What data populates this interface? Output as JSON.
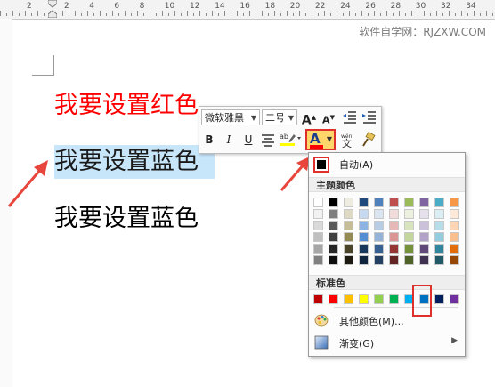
{
  "ruler": {
    "numbers": [
      "2",
      "2",
      "4",
      "6",
      "8",
      "10",
      "12",
      "14",
      "16",
      "18",
      "20",
      "22",
      "24",
      "26",
      "28",
      "30",
      "32",
      "34"
    ]
  },
  "watermark": "软件自学网：RJZXW.COM",
  "document": {
    "line1": "我要设置红色",
    "line2": "我要设置蓝色",
    "line3": "我要设置蓝色"
  },
  "mini_toolbar": {
    "font_name": "微软雅黑",
    "font_size": "二号",
    "grow_label": "A",
    "shrink_label": "A",
    "bold_label": "B",
    "italic_label": "I",
    "underline_label": "U",
    "font_color_letter": "A",
    "font_color_bar_color": "#ff0000"
  },
  "color_menu": {
    "automatic_label": "自动(A)",
    "theme_header": "主题颜色",
    "standard_header": "标准色",
    "more_colors_label": "其他颜色(M)...",
    "gradient_label": "渐变(G)",
    "theme_colors": [
      [
        "#ffffff",
        "#f2f2f2",
        "#d9d9d9",
        "#bfbfbf",
        "#a6a6a6",
        "#808080"
      ],
      [
        "#000000",
        "#7f7f7f",
        "#595959",
        "#404040",
        "#262626",
        "#0d0d0d"
      ],
      [
        "#eeece1",
        "#ddd9c4",
        "#c4bd97",
        "#948a54",
        "#4a452a",
        "#1d1b11"
      ],
      [
        "#1f497d",
        "#c6d9f1",
        "#8db3e2",
        "#548dd4",
        "#17375e",
        "#0f243e"
      ],
      [
        "#4f81bd",
        "#dbe5f1",
        "#b8cce4",
        "#95b3d7",
        "#366092",
        "#244062"
      ],
      [
        "#c0504d",
        "#f2dcdb",
        "#e6b9b8",
        "#da9694",
        "#963634",
        "#632523"
      ],
      [
        "#9bbb59",
        "#ebf1de",
        "#d7e4bd",
        "#c3d69b",
        "#76933c",
        "#4f6228"
      ],
      [
        "#8064a2",
        "#e5e0ec",
        "#ccc1da",
        "#b3a2c7",
        "#60497a",
        "#3f3151"
      ],
      [
        "#4bacc6",
        "#dbeef4",
        "#b7dee8",
        "#93cddd",
        "#31859c",
        "#215968"
      ],
      [
        "#f79646",
        "#fde9d9",
        "#fcd5b4",
        "#fabf8f",
        "#e26b0a",
        "#974706"
      ]
    ],
    "standard_colors": [
      "#c00000",
      "#ff0000",
      "#ffc000",
      "#ffff00",
      "#92d050",
      "#00b050",
      "#00b0f0",
      "#0070c0",
      "#002060",
      "#7030a0"
    ]
  }
}
